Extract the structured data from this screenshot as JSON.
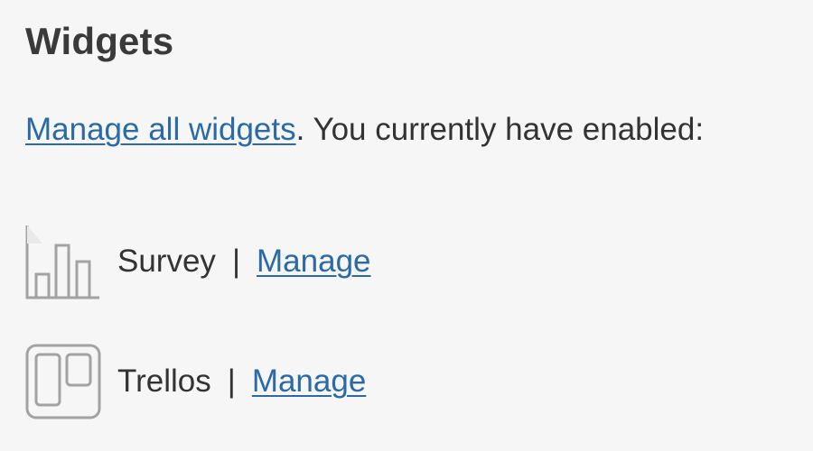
{
  "widgets_panel": {
    "title": "Widgets",
    "manage_all_link": "Manage all widgets",
    "intro_suffix": ". You currently have enabled:",
    "separator": "|",
    "colors": {
      "background": "#f6f6f6",
      "text": "#333333",
      "link": "#2a6aa6",
      "icon": "#9a9a9a"
    },
    "items": [
      {
        "name": "Survey",
        "icon": "bar-chart-icon",
        "manage_label": "Manage"
      },
      {
        "name": "Trellos",
        "icon": "board-icon",
        "manage_label": "Manage"
      }
    ]
  }
}
